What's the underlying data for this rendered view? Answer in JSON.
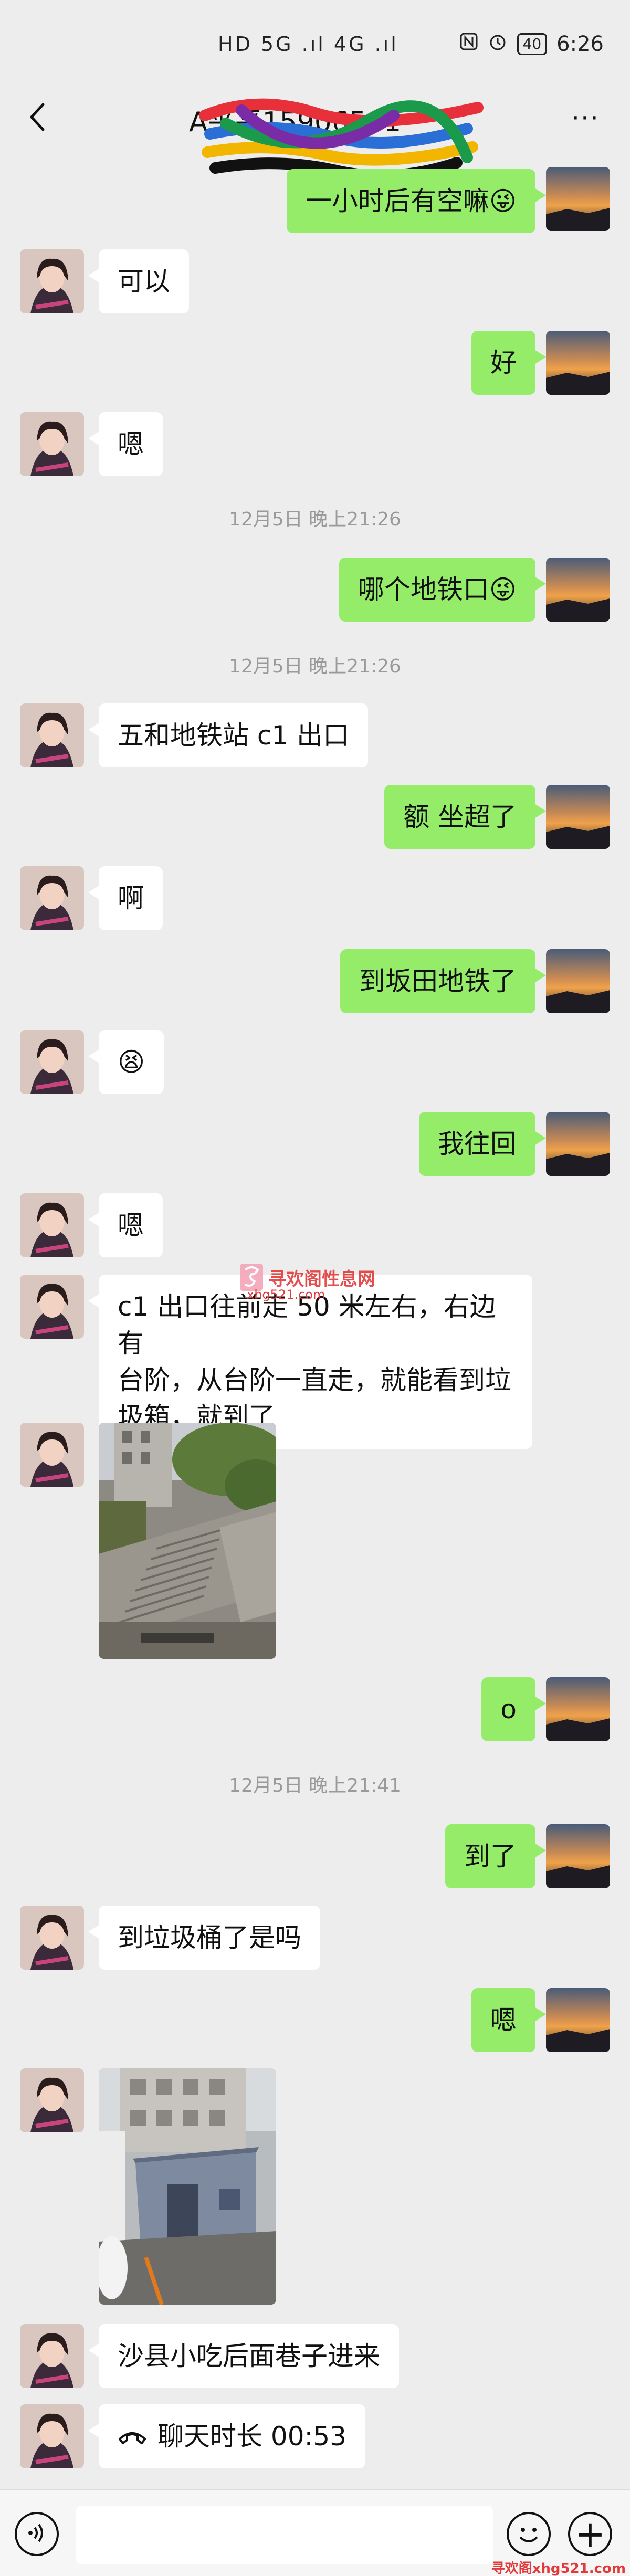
{
  "status_bar": {
    "network": "HD 5G .ıl 4G .ıl",
    "time": "6:26",
    "battery": "40"
  },
  "header": {
    "title": "A平平15906581",
    "back_icon": "chevron-left-icon",
    "more_icon": "more-dots-icon",
    "more_label": "···"
  },
  "messages": [
    {
      "side": "out",
      "type": "text",
      "text": "一小时后有空嘛😜"
    },
    {
      "side": "in",
      "type": "text",
      "text": "可以"
    },
    {
      "side": "out",
      "type": "text",
      "text": "好"
    },
    {
      "side": "in",
      "type": "text",
      "text": "嗯"
    },
    {
      "type": "timestamp",
      "text": "12月5日 晚上21:26"
    },
    {
      "side": "out",
      "type": "text",
      "text": "哪个地铁口😜"
    },
    {
      "type": "timestamp",
      "text": "12月5日 晚上21:26"
    },
    {
      "side": "in",
      "type": "text",
      "text": "五和地铁站 c1 出口"
    },
    {
      "side": "out",
      "type": "text",
      "text": "额  坐超了"
    },
    {
      "side": "in",
      "type": "text",
      "text": "啊"
    },
    {
      "side": "out",
      "type": "text",
      "text": "到坂田地铁了"
    },
    {
      "side": "in",
      "type": "emoji",
      "text": "😫"
    },
    {
      "side": "out",
      "type": "text",
      "text": "我往回"
    },
    {
      "side": "in",
      "type": "text",
      "text": "嗯"
    },
    {
      "side": "in",
      "type": "text",
      "text_lines": [
        "c1 出口往前走 50 米左右，右边有",
        "台阶，从台阶一直走，就能看到垃",
        "圾箱，就到了"
      ]
    },
    {
      "side": "in",
      "type": "image",
      "subject": "stairs-photo"
    },
    {
      "side": "out",
      "type": "text",
      "text": "o"
    },
    {
      "type": "timestamp",
      "text": "12月5日 晚上21:41"
    },
    {
      "side": "out",
      "type": "text",
      "text": "到了"
    },
    {
      "side": "in",
      "type": "text",
      "text": "到垃圾桶了是吗"
    },
    {
      "side": "out",
      "type": "text",
      "text": "嗯"
    },
    {
      "side": "in",
      "type": "image",
      "subject": "alley-photo"
    },
    {
      "side": "in",
      "type": "text",
      "text": "沙县小吃后面巷子进来"
    },
    {
      "side": "in",
      "type": "call",
      "text": "聊天时长 00:53",
      "icon": "phone-icon"
    }
  ],
  "watermark": {
    "title": "寻欢阁性息网",
    "url": "xhg521.com"
  },
  "input_bar": {
    "voice_icon": "voice-icon",
    "emoji_icon": "emoji-icon",
    "plus_icon": "plus-icon",
    "plus_label": "+"
  },
  "footer_mark": "寻欢阁xhg521.com",
  "colors": {
    "background": "#ededed",
    "outgoing_bubble": "#95ec69",
    "incoming_bubble": "#ffffff",
    "timestamp_text": "#9a9a9a",
    "watermark": "#e23a3a"
  }
}
